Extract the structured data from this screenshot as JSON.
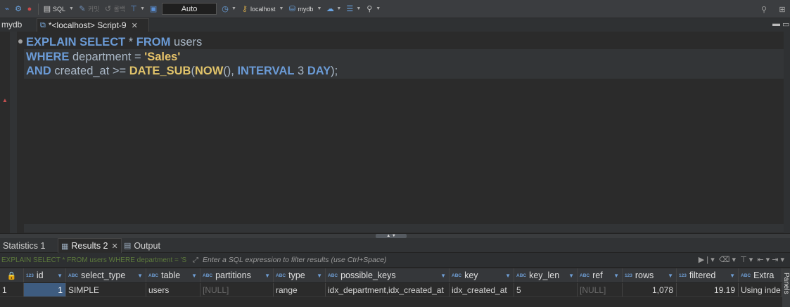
{
  "toolbar": {
    "sql_label": "SQL",
    "commit_label": "커밋",
    "rollback_label": "롤백",
    "transaction_mode": "Auto",
    "connection": "localhost",
    "database": "mydb"
  },
  "editor": {
    "db_name": "mydb",
    "tab_label": "*<localhost> Script-9",
    "code_lines": [
      [
        {
          "t": "EXPLAIN SELECT",
          "c": "kw"
        },
        {
          "t": " * ",
          "c": "plain"
        },
        {
          "t": "FROM",
          "c": "kw"
        },
        {
          "t": " users",
          "c": "plain"
        }
      ],
      [
        {
          "t": "WHERE",
          "c": "kw"
        },
        {
          "t": " department = ",
          "c": "plain"
        },
        {
          "t": "'Sales'",
          "c": "str"
        }
      ],
      [
        {
          "t": "AND",
          "c": "kw"
        },
        {
          "t": " created_at >= ",
          "c": "plain"
        },
        {
          "t": "DATE_SUB",
          "c": "fn"
        },
        {
          "t": "(",
          "c": "plain"
        },
        {
          "t": "NOW",
          "c": "fn"
        },
        {
          "t": "(), ",
          "c": "plain"
        },
        {
          "t": "INTERVAL",
          "c": "kw"
        },
        {
          "t": " 3 ",
          "c": "plain"
        },
        {
          "t": "DAY",
          "c": "kw"
        },
        {
          "t": ");",
          "c": "plain"
        }
      ]
    ]
  },
  "results": {
    "tabs": [
      {
        "label": "Statistics 1",
        "active": false
      },
      {
        "label": "Results 2",
        "active": true
      },
      {
        "label": "Output",
        "active": false
      }
    ],
    "filter_sql": "EXPLAIN SELECT * FROM users WHERE department = 'S",
    "filter_placeholder": "Enter a SQL expression to filter results (use Ctrl+Space)",
    "columns": [
      {
        "name": "id",
        "type": "123"
      },
      {
        "name": "select_type",
        "type": "ABC"
      },
      {
        "name": "table",
        "type": "ABC"
      },
      {
        "name": "partitions",
        "type": "ABC"
      },
      {
        "name": "type",
        "type": "ABC"
      },
      {
        "name": "possible_keys",
        "type": "ABC"
      },
      {
        "name": "key",
        "type": "ABC"
      },
      {
        "name": "key_len",
        "type": "ABC"
      },
      {
        "name": "ref",
        "type": "ABC"
      },
      {
        "name": "rows",
        "type": "123"
      },
      {
        "name": "filtered",
        "type": "123"
      },
      {
        "name": "Extra",
        "type": "ABC"
      }
    ],
    "rows": [
      {
        "row_num": "1",
        "cells": [
          "1",
          "SIMPLE",
          "users",
          "[NULL]",
          "range",
          "idx_department,idx_created_at",
          "idx_created_at",
          "5",
          "[NULL]",
          "1,078",
          "19.19",
          "Using inde"
        ]
      }
    ],
    "panels_label": "Panels"
  },
  "colors": {
    "keyword": "#6b9bd6",
    "string": "#e8c46a",
    "background": "#2b2b2b",
    "selection": "#3e5c80"
  }
}
